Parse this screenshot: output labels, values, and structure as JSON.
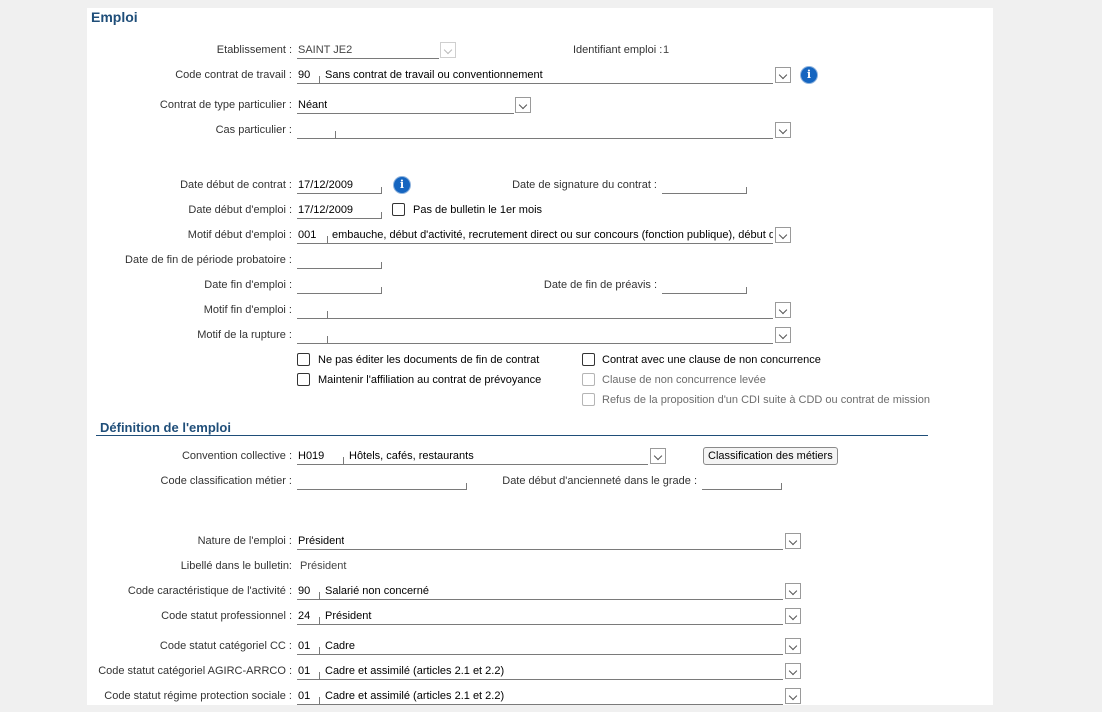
{
  "emploi": {
    "title": "Emploi",
    "etablissement": {
      "label": "Etablissement :",
      "value": "SAINT JE2"
    },
    "identifiant": {
      "label": "Identifiant emploi :",
      "value": "1"
    },
    "code_contrat": {
      "label": "Code contrat de travail :",
      "code": "90",
      "text": "Sans contrat de travail ou conventionnement"
    },
    "contrat_particulier": {
      "label": "Contrat de type particulier :",
      "value": "Néant"
    },
    "cas_particulier": {
      "label": "Cas particulier :",
      "value": ""
    },
    "date_debut_contrat": {
      "label": "Date début de contrat :",
      "value": "17/12/2009"
    },
    "date_signature": {
      "label": "Date de signature du contrat :",
      "value": ""
    },
    "date_debut_emploi": {
      "label": "Date début d'emploi :",
      "value": "17/12/2009"
    },
    "pas_bulletin": {
      "label": "Pas de bulletin le 1er mois",
      "checked": false
    },
    "motif_debut": {
      "label": "Motif début d'emploi :",
      "code": "001",
      "text": "embauche, début d'activité, recrutement direct ou sur concours (fonction publique), début de c"
    },
    "date_fin_probatoire": {
      "label": "Date de fin de période probatoire :",
      "value": ""
    },
    "date_fin_emploi": {
      "label": "Date fin d'emploi :",
      "value": ""
    },
    "date_fin_preavis": {
      "label": "Date de fin de préavis :",
      "value": ""
    },
    "motif_fin": {
      "label": "Motif fin d'emploi :",
      "value": ""
    },
    "motif_rupture": {
      "label": "Motif de la rupture :",
      "value": ""
    },
    "checkboxes": {
      "ne_pas_editer": "Ne pas éditer les documents de fin de contrat",
      "maintenir_affiliation": "Maintenir l'affiliation au contrat de prévoyance",
      "clause_non_concurrence": "Contrat avec une clause de non concurrence",
      "clause_levee": "Clause de non concurrence levée",
      "refus_cdi": "Refus de la proposition d'un CDI suite à CDD ou contrat de mission"
    }
  },
  "definition": {
    "title": "Définition de l'emploi",
    "convention": {
      "label": "Convention collective :",
      "code": "H019",
      "text": "Hôtels, cafés, restaurants"
    },
    "classification_button": "Classification des métiers",
    "code_classification": {
      "label": "Code classification métier :",
      "value": ""
    },
    "date_anciennete": {
      "label": "Date début d'ancienneté dans le grade :",
      "value": ""
    },
    "nature_emploi": {
      "label": "Nature de l'emploi :",
      "value": "Président"
    },
    "libelle_bulletin": {
      "label": "Libellé dans le bulletin:",
      "value": "Président"
    },
    "code_caracteristique": {
      "label": "Code caractéristique de l'activité :",
      "code": "90",
      "text": "Salarié non concerné"
    },
    "code_statut_pro": {
      "label": "Code statut professionnel :",
      "code": "24",
      "text": "Président"
    },
    "code_statut_cc": {
      "label": "Code statut catégoriel CC :",
      "code": "01",
      "text": "Cadre"
    },
    "code_statut_agirc": {
      "label": "Code statut catégoriel AGIRC-ARRCO :",
      "code": "01",
      "text": "Cadre et assimilé (articles 2.1 et 2.2)"
    },
    "code_statut_regime": {
      "label": "Code statut régime protection sociale :",
      "code": "01",
      "text": "Cadre et assimilé (articles 2.1 et 2.2)"
    }
  },
  "colors": {
    "heading": "#1f4e79",
    "info_icon": "#1565c0"
  }
}
